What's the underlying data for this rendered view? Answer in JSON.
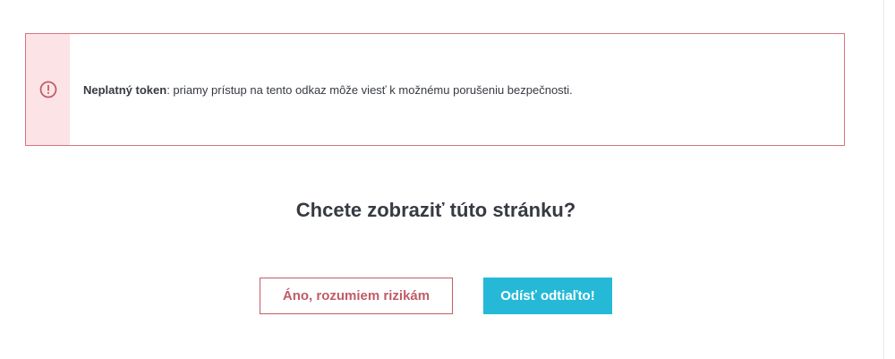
{
  "alert": {
    "icon": "exclamation-circle-icon",
    "title": "Neplatný token",
    "message": ": priamy prístup na tento odkaz môže viesť k možnému porušeniu bezpečnosti."
  },
  "question": "Chcete zobraziť túto stránku?",
  "buttons": {
    "accept_risk_label": "Áno, rozumiem rizikám",
    "leave_label": "Odísť odtiaľto!"
  },
  "colors": {
    "danger": "#c05c67",
    "danger_bg": "#fce4e6",
    "primary": "#25b9d7"
  }
}
